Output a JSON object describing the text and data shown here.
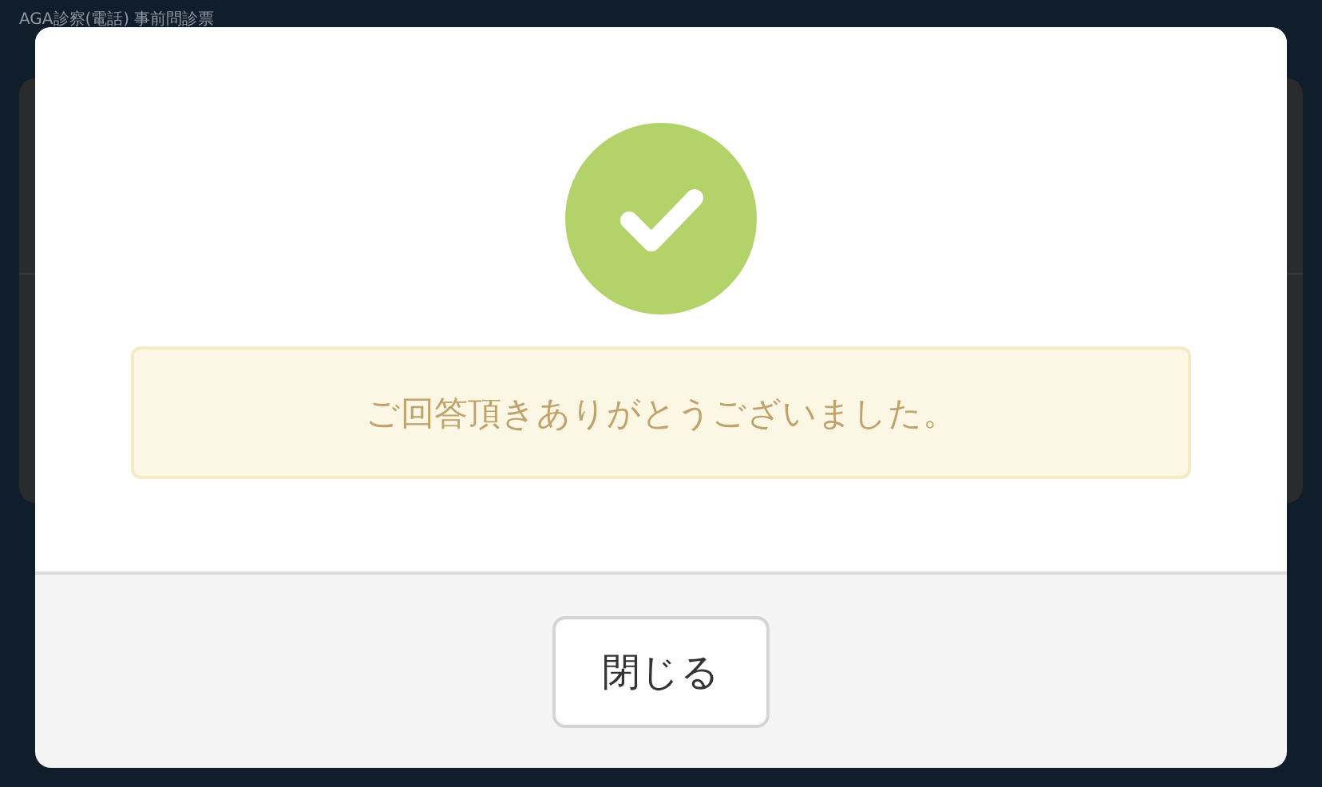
{
  "page": {
    "title": "AGA診察(電話) 事前問診票"
  },
  "dialog": {
    "message": "ご回答頂きありがとうございました。",
    "buttons": [
      "閉じる"
    ]
  }
}
